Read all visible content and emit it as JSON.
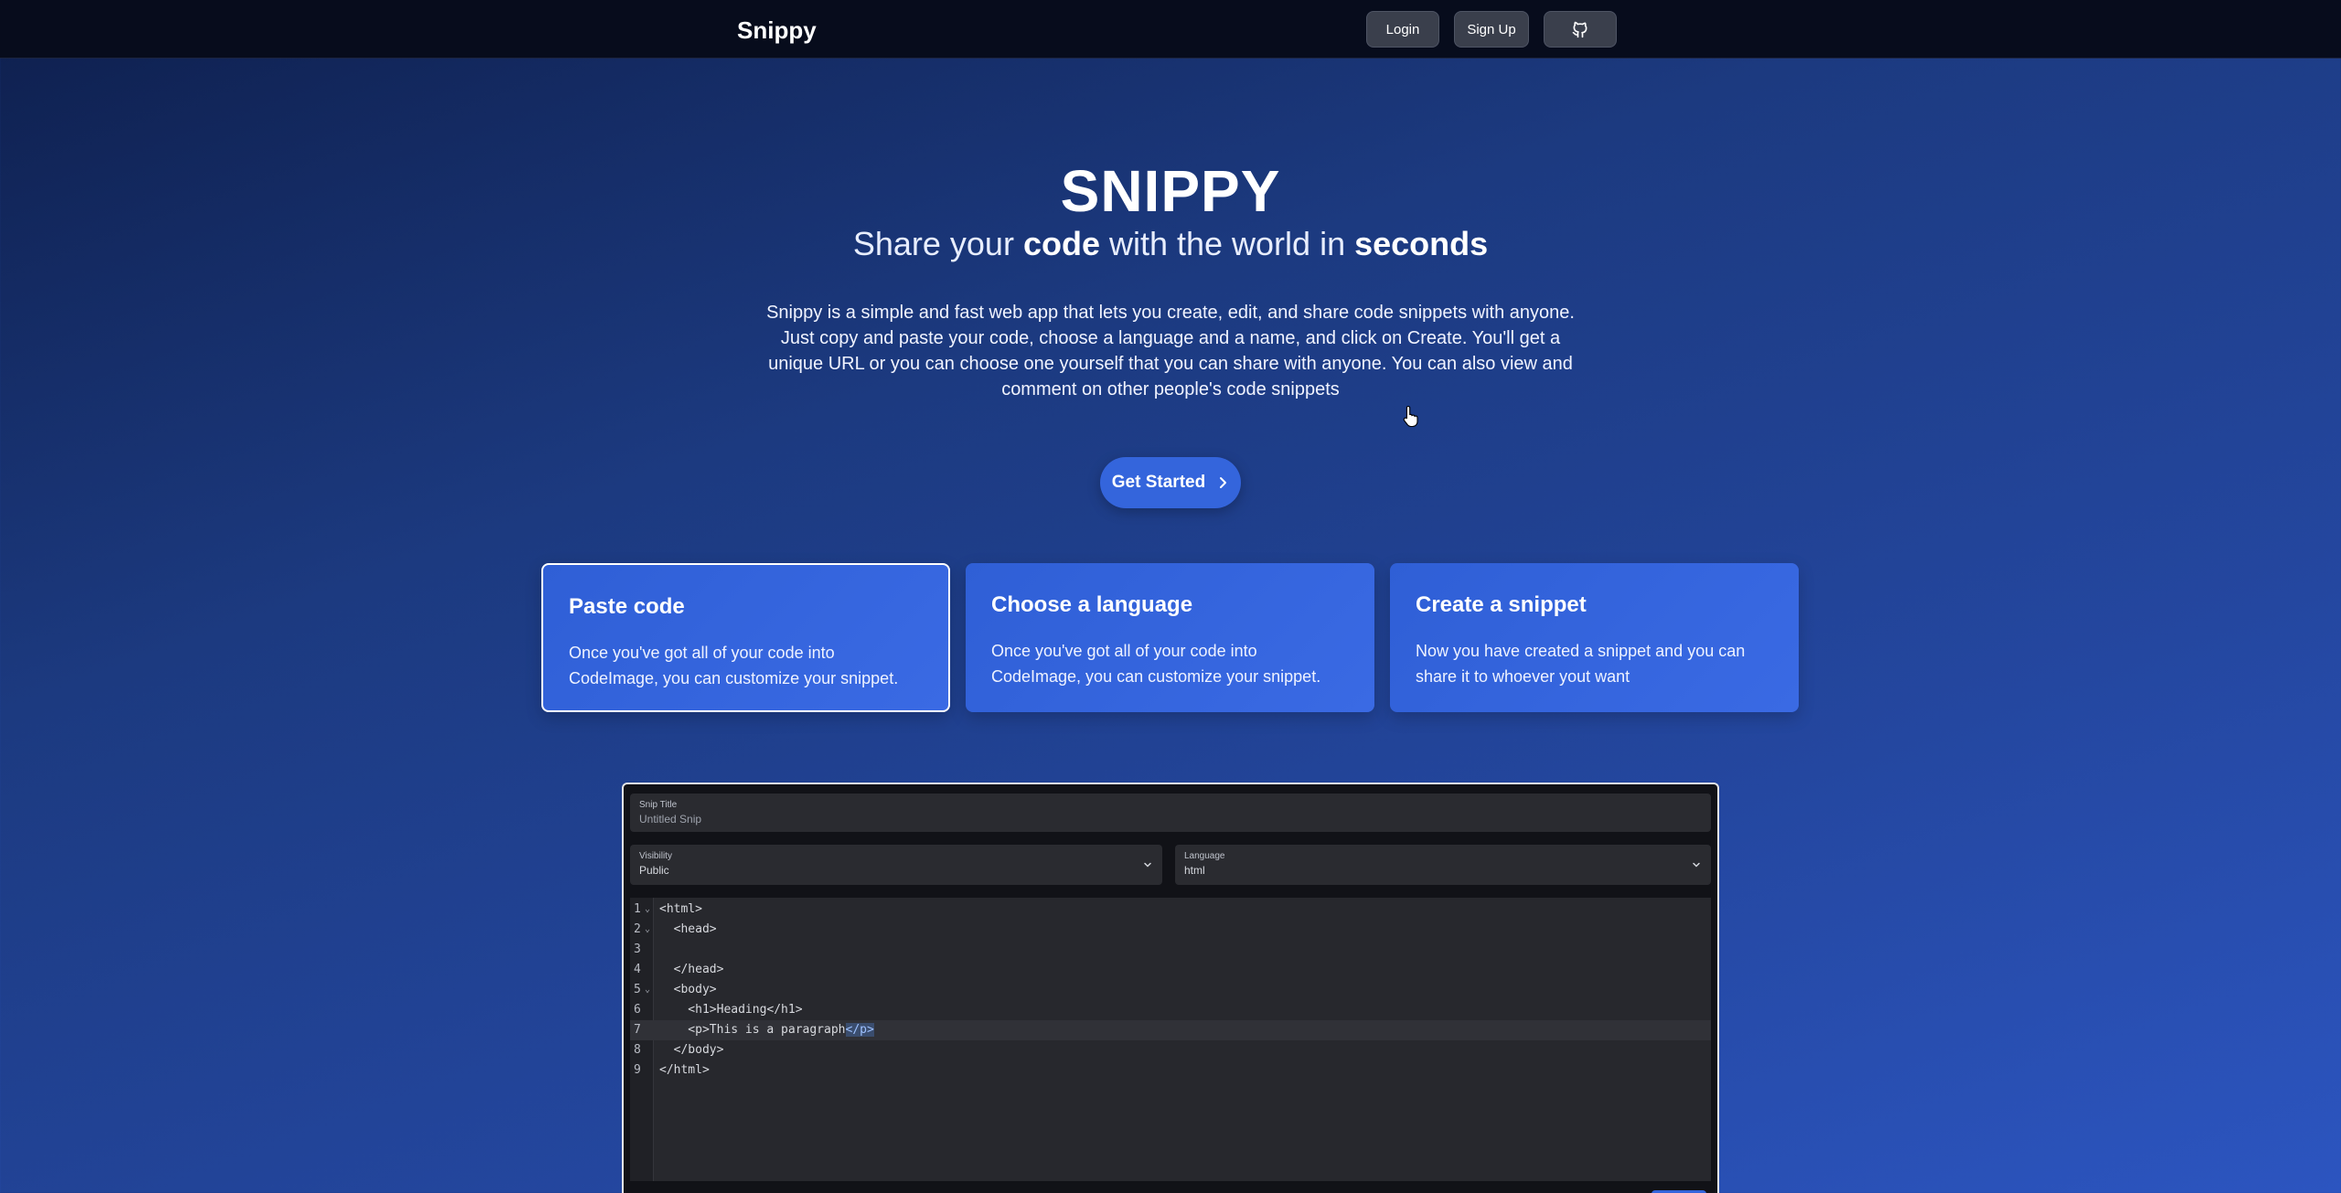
{
  "nav": {
    "brand": "Snippy",
    "login": "Login",
    "signup": "Sign Up",
    "github_icon": "github-icon"
  },
  "hero": {
    "title": "SNIPPY",
    "sub_1": "Share your ",
    "sub_code": "code",
    "sub_2": " with the world in ",
    "sub_seconds": "seconds",
    "description": "Snippy is a simple and fast web app that lets you create, edit, and share code snippets with anyone. Just copy and paste your code, choose a language and a name, and click on Create. You'll get a unique URL or you can choose one yourself that you can share with anyone. You can also view and comment on other people's code snippets",
    "cta": "Get Started",
    "cta_icon": "chevron-right-icon"
  },
  "cards": [
    {
      "title": "Paste code",
      "text": "Once you've got all of your code into CodeImage, you can customize your snippet."
    },
    {
      "title": "Choose a language",
      "text": "Once you've got all of your code into CodeImage, you can customize your snippet."
    },
    {
      "title": "Create a snippet",
      "text": "Now you have created a snippet and you can share it to whoever yout want"
    }
  ],
  "editor": {
    "title_label": "Snip Title",
    "title_placeholder": "Untitled Snip",
    "visibility_label": "Visibility",
    "visibility_value": "Public",
    "language_label": "Language",
    "language_value": "html",
    "lines": [
      {
        "n": "1",
        "fold": true,
        "text": "<html>"
      },
      {
        "n": "2",
        "fold": true,
        "text": "  <head>"
      },
      {
        "n": "3",
        "fold": false,
        "text": ""
      },
      {
        "n": "4",
        "fold": false,
        "text": "  </head>"
      },
      {
        "n": "5",
        "fold": true,
        "text": "  <body>"
      },
      {
        "n": "6",
        "fold": false,
        "text": "    <h1>Heading</h1>"
      },
      {
        "n": "7",
        "fold": false,
        "text_pre": "    <p>This is a paragraph",
        "text_hl": "</p>"
      },
      {
        "n": "8",
        "fold": false,
        "text": "  </body>"
      },
      {
        "n": "9",
        "fold": false,
        "text": "</html>"
      }
    ]
  }
}
